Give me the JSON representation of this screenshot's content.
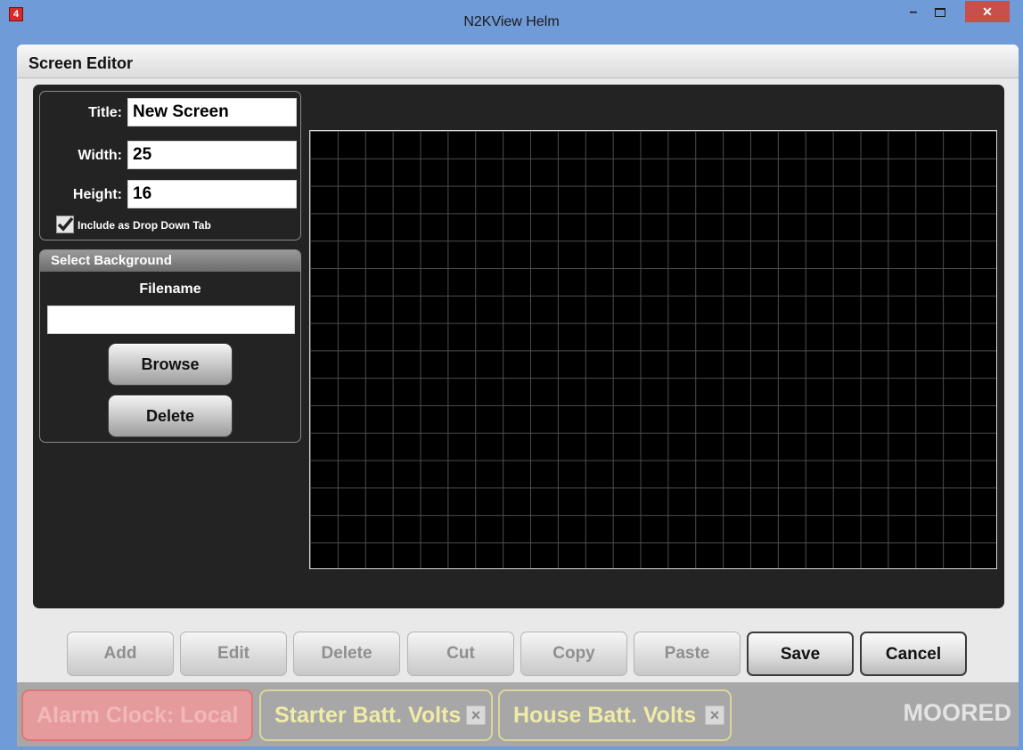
{
  "window": {
    "title": "N2KView Helm",
    "minimize_label": "–",
    "close_label": "✕"
  },
  "editor": {
    "title": "Screen Editor"
  },
  "properties": {
    "title_label": "Title:",
    "title_value": "New Screen",
    "width_label": "Width:",
    "width_value": "25",
    "height_label": "Height:",
    "height_value": "16",
    "dropdown_tab_label": "Include as Drop Down Tab",
    "dropdown_tab_checked": true
  },
  "background": {
    "header": "Select Background",
    "filename_label": "Filename",
    "filename_value": "",
    "browse_label": "Browse",
    "delete_label": "Delete"
  },
  "grid": {
    "columns": 25,
    "rows": 16
  },
  "toolbar": {
    "add": "Add",
    "edit": "Edit",
    "delete": "Delete",
    "cut": "Cut",
    "copy": "Copy",
    "paste": "Paste",
    "save": "Save",
    "cancel": "Cancel"
  },
  "status": {
    "alarm": "Alarm Clock: Local",
    "starter": "Starter Batt. Volts",
    "house": "House Batt. Volts",
    "dismiss": "×",
    "mode": "MOORED"
  },
  "colors": {
    "accent": "#6f9bd8",
    "alarm": "#e59b9b",
    "alert_border": "#ddd69a"
  }
}
